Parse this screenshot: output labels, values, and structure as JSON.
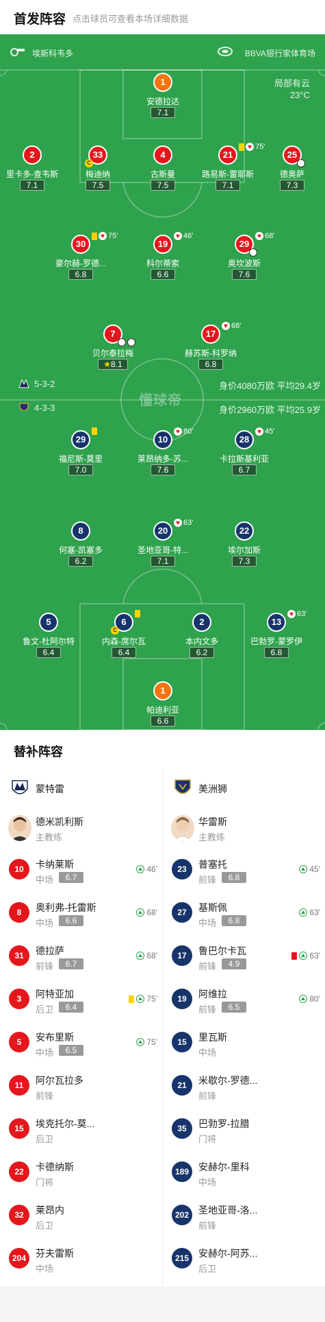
{
  "header": {
    "title": "首发阵容",
    "subtitle": "点击球员可查看本场详细数据"
  },
  "pitch": {
    "referee": "埃斯科韦多",
    "stadium": "BBVA银行家体育场",
    "weather": [
      "局部有云",
      "23°C"
    ],
    "watermark": "懂球帝",
    "home_formation": {
      "text": "5-3-2",
      "value": "身价4080万欧  平均29.4岁"
    },
    "away_formation": {
      "text": "4-3-3",
      "value": "身价2960万欧  平均25.9岁"
    }
  },
  "home_players": [
    {
      "num": "1",
      "name": "安德拉达",
      "rating": "7.1",
      "color": "orange"
    },
    {
      "num": "2",
      "name": "里卡多-查韦斯",
      "rating": "7.1",
      "color": "red"
    },
    {
      "num": "33",
      "name": "梅迪纳",
      "rating": "7.5",
      "color": "red"
    },
    {
      "num": "4",
      "name": "古斯曼",
      "rating": "7.5",
      "color": "red"
    },
    {
      "num": "21",
      "name": "路易斯-雷耶斯",
      "rating": "7.1",
      "color": "red",
      "event": "75'"
    },
    {
      "num": "25",
      "name": "德奥萨",
      "rating": "7.3",
      "color": "red"
    },
    {
      "num": "30",
      "name": "豪尔赫-罗德...",
      "rating": "6.8",
      "color": "red",
      "event": "75'"
    },
    {
      "num": "19",
      "name": "科尔蒂索",
      "rating": "6.6",
      "color": "red",
      "event": "46'"
    },
    {
      "num": "29",
      "name": "奥坎波斯",
      "rating": "7.6",
      "color": "red",
      "event": "68'"
    },
    {
      "num": "7",
      "name": "贝尔泰拉梅",
      "rating": "8.1",
      "color": "red"
    },
    {
      "num": "17",
      "name": "赫苏斯-科罗纳",
      "rating": "6.8",
      "color": "red",
      "event": "68'"
    }
  ],
  "away_players": [
    {
      "num": "29",
      "name": "福尼斯-莫里",
      "rating": "7.0",
      "color": "navy"
    },
    {
      "num": "10",
      "name": "莱昂纳多-苏...",
      "rating": "7.6",
      "color": "navy",
      "event": "80'"
    },
    {
      "num": "28",
      "name": "卡拉斯基利亚",
      "rating": "6.7",
      "color": "navy",
      "event": "45'"
    },
    {
      "num": "8",
      "name": "何塞-凯塞多",
      "rating": "6.2",
      "color": "navy"
    },
    {
      "num": "20",
      "name": "圣地亚哥-特...",
      "rating": "7.1",
      "color": "navy",
      "event": "63'"
    },
    {
      "num": "22",
      "name": "埃尔加斯",
      "rating": "7.3",
      "color": "navy"
    },
    {
      "num": "5",
      "name": "鲁文-杜阿尔特",
      "rating": "6.4",
      "color": "navy"
    },
    {
      "num": "6",
      "name": "内森-席尔瓦",
      "rating": "6.4",
      "color": "navy"
    },
    {
      "num": "2",
      "name": "本内文多",
      "rating": "6.2",
      "color": "navy"
    },
    {
      "num": "13",
      "name": "巴勃罗-蒙罗伊",
      "rating": "6.8",
      "color": "navy",
      "event": "63'"
    },
    {
      "num": "1",
      "name": "帕迪利亚",
      "rating": "6.6",
      "color": "orange"
    }
  ],
  "subs": {
    "title": "替补阵容",
    "home": {
      "team": "蒙特雷",
      "coach": {
        "name": "德米凯利斯",
        "role": "主教练"
      },
      "players": [
        {
          "num": "10",
          "name": "卡纳莱斯",
          "pos": "中场",
          "rating": "6.7",
          "event": "46'"
        },
        {
          "num": "8",
          "name": "奥利弗-托雷斯",
          "pos": "中场",
          "rating": "6.6",
          "event": "68'"
        },
        {
          "num": "31",
          "name": "德拉萨",
          "pos": "前锋",
          "rating": "6.7",
          "event": "68'"
        },
        {
          "num": "3",
          "name": "阿特亚加",
          "pos": "后卫",
          "rating": "6.4",
          "event": "75'"
        },
        {
          "num": "5",
          "name": "安布里斯",
          "pos": "中场",
          "rating": "6.5",
          "event": "75'"
        },
        {
          "num": "11",
          "name": "阿尔瓦拉多",
          "pos": "前锋"
        },
        {
          "num": "15",
          "name": "埃克托尔-莫...",
          "pos": "后卫"
        },
        {
          "num": "22",
          "name": "卡德纳斯",
          "pos": "门将"
        },
        {
          "num": "32",
          "name": "莱昂内",
          "pos": "后卫"
        },
        {
          "num": "204",
          "name": "芬夫雷斯",
          "pos": "中场"
        }
      ]
    },
    "away": {
      "team": "美洲狮",
      "coach": {
        "name": "华雷斯",
        "role": "主教练"
      },
      "players": [
        {
          "num": "23",
          "name": "普塞托",
          "pos": "前锋",
          "rating": "6.8",
          "event": "45'"
        },
        {
          "num": "27",
          "name": "基斯佩",
          "pos": "中场",
          "rating": "6.8",
          "event": "63'"
        },
        {
          "num": "17",
          "name": "鲁巴尔卡瓦",
          "pos": "前锋",
          "rating": "4.9",
          "event": "63'"
        },
        {
          "num": "19",
          "name": "阿维拉",
          "pos": "前锋",
          "rating": "6.5",
          "event": "80'"
        },
        {
          "num": "15",
          "name": "里瓦斯",
          "pos": "中场"
        },
        {
          "num": "21",
          "name": "米歇尔-罗德...",
          "pos": "前锋"
        },
        {
          "num": "35",
          "name": "巴勃罗-拉腊",
          "pos": "门将"
        },
        {
          "num": "189",
          "name": "安赫尔-里科",
          "pos": "中场"
        },
        {
          "num": "202",
          "name": "圣地亚哥-洛...",
          "pos": "前锋"
        },
        {
          "num": "215",
          "name": "安赫尔-阿苏...",
          "pos": "后卫"
        }
      ]
    }
  }
}
